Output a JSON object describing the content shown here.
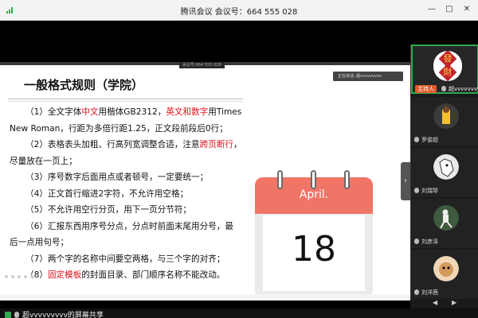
{
  "window": {
    "title": "腾讯会议 会议号：664 555 028"
  },
  "slide": {
    "meeting_tag": "会议号:664 555 028",
    "heading": "一般格式规则（学院）",
    "speaking_label": "正在讲话: 超vvvvvvvvv",
    "lines": [
      {
        "parts": [
          {
            "t": "（1）全文字体"
          },
          {
            "t": "中文",
            "red": true
          },
          {
            "t": "用楷体GB2312，"
          },
          {
            "t": "英文和数字",
            "red": true
          },
          {
            "t": "用Times"
          }
        ],
        "indent": true
      },
      {
        "parts": [
          {
            "t": "New Roman，行距为多倍行距1.25，正文段前段后0行；"
          }
        ],
        "indent": false
      },
      {
        "parts": [
          {
            "t": "（2）表格表头加粗、行高列宽调整合适，注意"
          },
          {
            "t": "跨页断行",
            "red": true
          },
          {
            "t": "，"
          }
        ],
        "indent": true
      },
      {
        "parts": [
          {
            "t": "尽量放在一页上；"
          }
        ],
        "indent": false
      },
      {
        "parts": [
          {
            "t": "（3）序号数字后面用点或者顿号，一定要统一；"
          }
        ],
        "indent": true
      },
      {
        "parts": [
          {
            "t": "（4）正文首行缩进2字符，不允许用空格；"
          }
        ],
        "indent": true
      },
      {
        "parts": [
          {
            "t": "（5）不允许用空行分页，用下一页分节符；"
          }
        ],
        "indent": true
      },
      {
        "parts": [
          {
            "t": "（6）汇报东西用序号分点，分点时前面末尾用分号，最"
          }
        ],
        "indent": true
      },
      {
        "parts": [
          {
            "t": "后一点用句号；"
          }
        ],
        "indent": false
      },
      {
        "parts": [
          {
            "t": "（7）两个字的名称中间要空两格，与三个字的对齐；"
          }
        ],
        "indent": true
      },
      {
        "parts": [
          {
            "t": "（8）"
          },
          {
            "t": "固定模板",
            "red": true
          },
          {
            "t": "的封面目录、部门顺序名称不能改动。"
          }
        ],
        "indent": true
      }
    ],
    "calendar": {
      "month": "April.",
      "day": "18"
    }
  },
  "participants": {
    "host": {
      "badge": "主持人",
      "name": "超vvvvvvvvv",
      "avatar_chars": [
        "發",
        "財"
      ]
    },
    "others": [
      {
        "name": "罗俊超",
        "avatar_icon": "basketball-player-icon"
      },
      {
        "name": "刘瑞琴",
        "avatar_icon": "white-dog-icon"
      },
      {
        "name": "刘彦泽",
        "avatar_icon": "soccer-player-icon"
      },
      {
        "name": "刘洋茜",
        "avatar_icon": "dog-photo-icon"
      }
    ]
  },
  "bottom_bar": {
    "share_text": "超vvvvvvvvv的屏幕共享"
  },
  "colors": {
    "accent_green": "#2eaa4f",
    "highlight_red": "#e0101a",
    "calendar_red": "#f07567",
    "host_badge": "#e05a2a"
  }
}
